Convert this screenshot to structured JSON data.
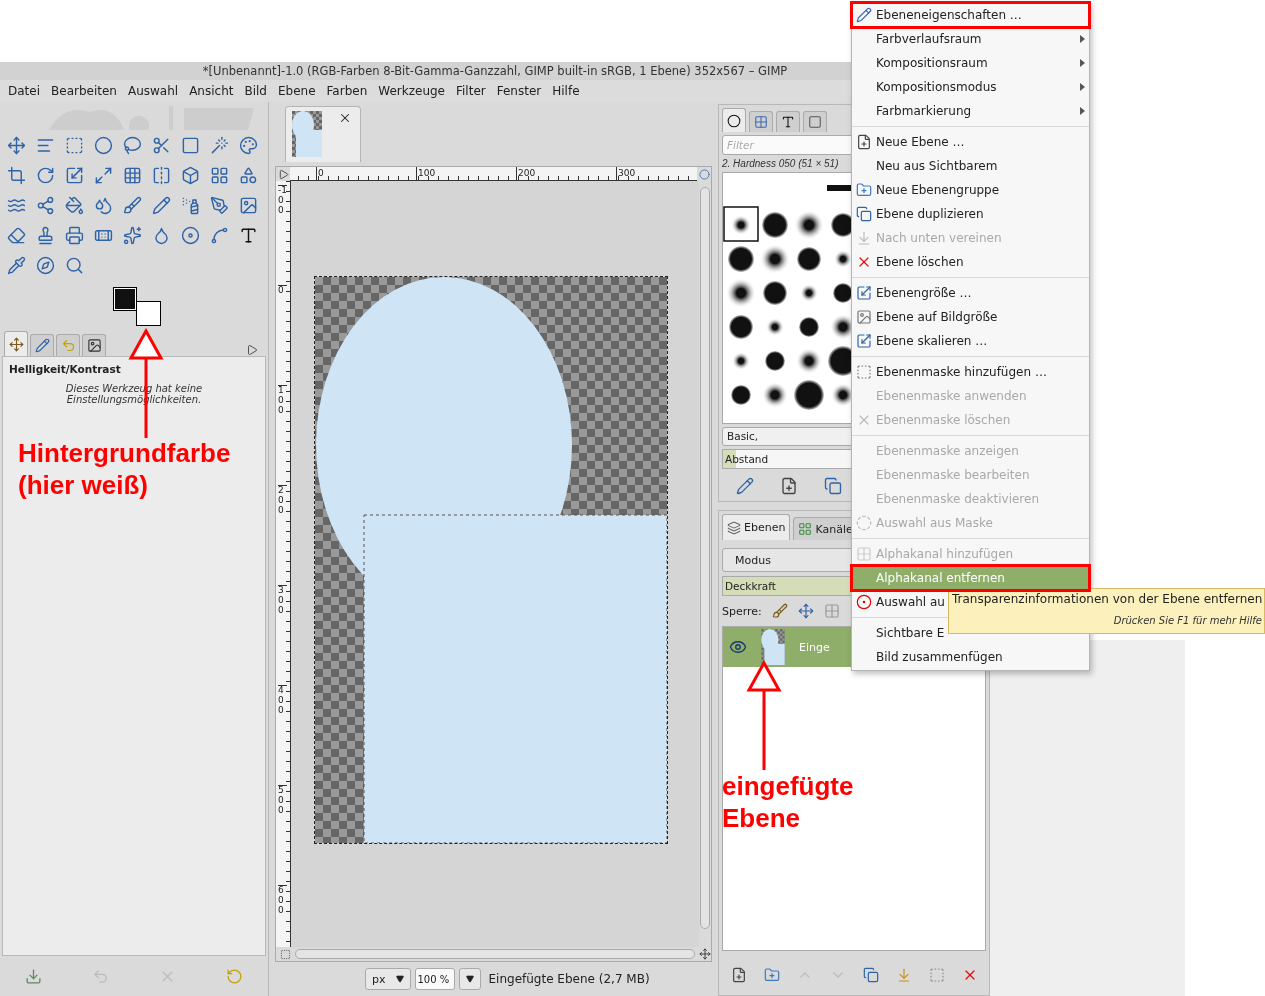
{
  "window": {
    "title": "*[Unbenannt]-1.0 (RGB-Farben 8-Bit-Gamma-Ganzzahl, GIMP built-in sRGB, 1 Ebene) 352x567 – GIMP"
  },
  "menubar": [
    "Datei",
    "Bearbeiten",
    "Auswahl",
    "Ansicht",
    "Bild",
    "Ebene",
    "Farben",
    "Werkzeuge",
    "Filter",
    "Fenster",
    "Hilfe"
  ],
  "toolbox": {
    "options_tabs": [
      {
        "selected": true
      },
      {
        "selected": false
      },
      {
        "selected": false
      },
      {
        "selected": false
      }
    ]
  },
  "tool_options": {
    "title": "Helligkeit/Kontrast",
    "message": "Dieses Werkzeug hat keine Einstellungsmöglichkeiten."
  },
  "image_window": {
    "horizontal_ruler": [
      "0",
      "100",
      "200",
      "300"
    ],
    "vertical_ruler": [
      "-100",
      "0",
      "100",
      "200",
      "300",
      "400",
      "500",
      "600"
    ],
    "unit": "px",
    "zoom": "100 %",
    "status": "Eingefügte Ebene (2,7 MB)"
  },
  "brushes": {
    "tabs": [
      {
        "selected": true
      },
      {
        "selected": false
      },
      {
        "selected": false
      },
      {
        "selected": false
      }
    ],
    "filter_placeholder": "Filter",
    "current": "2. Hardness 050 (51 × 51)",
    "tags": "Basic,",
    "spacing": {
      "label": "Abstand",
      "level": 0.05
    }
  },
  "layers": {
    "tabs": [
      {
        "label": "Ebenen",
        "selected": true
      },
      {
        "label": "Kanäle",
        "selected": false
      }
    ],
    "mode": "Modus",
    "opacity": {
      "label": "Deckkraft",
      "level": 1
    },
    "lock_label": "Sperre:",
    "items": [
      {
        "name": "Einge",
        "visible": true,
        "selected": true
      }
    ]
  },
  "context_menu": {
    "sections": [
      {
        "items": [
          {
            "label": "Ebeneneigenschaften …",
            "disabled": false,
            "submenu": false,
            "highlighted": false,
            "annotated": true
          },
          {
            "label": "Farbverlaufsraum",
            "disabled": false,
            "submenu": true,
            "highlighted": false,
            "annotated": false
          },
          {
            "label": "Kompositionsraum",
            "disabled": false,
            "submenu": true,
            "highlighted": false,
            "annotated": false
          },
          {
            "label": "Kompositionsmodus",
            "disabled": false,
            "submenu": true,
            "highlighted": false,
            "annotated": false
          },
          {
            "label": "Farbmarkierung",
            "disabled": false,
            "submenu": true,
            "highlighted": false,
            "annotated": false
          }
        ]
      },
      {
        "items": [
          {
            "label": "Neue Ebene …",
            "disabled": false,
            "submenu": false,
            "highlighted": false,
            "annotated": false
          },
          {
            "label": "Neu aus Sichtbarem",
            "disabled": false,
            "submenu": false,
            "highlighted": false,
            "annotated": false
          },
          {
            "label": "Neue Ebenengruppe",
            "disabled": false,
            "submenu": false,
            "highlighted": false,
            "annotated": false
          },
          {
            "label": "Ebene duplizieren",
            "disabled": false,
            "submenu": false,
            "highlighted": false,
            "annotated": false
          },
          {
            "label": "Nach unten vereinen",
            "disabled": true,
            "submenu": false,
            "highlighted": false,
            "annotated": false
          },
          {
            "label": "Ebene löschen",
            "disabled": false,
            "submenu": false,
            "highlighted": false,
            "annotated": false
          }
        ]
      },
      {
        "items": [
          {
            "label": "Ebenengröße …",
            "disabled": false,
            "submenu": false,
            "highlighted": false,
            "annotated": false
          },
          {
            "label": "Ebene auf Bildgröße",
            "disabled": false,
            "submenu": false,
            "highlighted": false,
            "annotated": false
          },
          {
            "label": "Ebene skalieren …",
            "disabled": false,
            "submenu": false,
            "highlighted": false,
            "annotated": false
          }
        ]
      },
      {
        "items": [
          {
            "label": "Ebenenmaske hinzufügen …",
            "disabled": false,
            "submenu": false,
            "highlighted": false,
            "annotated": false
          },
          {
            "label": "Ebenenmaske anwenden",
            "disabled": true,
            "submenu": false,
            "highlighted": false,
            "annotated": false
          },
          {
            "label": "Ebenenmaske löschen",
            "disabled": true,
            "submenu": false,
            "highlighted": false,
            "annotated": false
          }
        ]
      },
      {
        "items": [
          {
            "label": "Ebenenmaske anzeigen",
            "disabled": true,
            "submenu": false,
            "highlighted": false,
            "annotated": false
          },
          {
            "label": "Ebenenmaske bearbeiten",
            "disabled": true,
            "submenu": false,
            "highlighted": false,
            "annotated": false
          },
          {
            "label": "Ebenenmaske deaktivieren",
            "disabled": true,
            "submenu": false,
            "highlighted": false,
            "annotated": false
          },
          {
            "label": "Auswahl aus Maske",
            "disabled": true,
            "submenu": false,
            "highlighted": false,
            "annotated": false
          }
        ]
      },
      {
        "items": [
          {
            "label": "Alphakanal hinzufügen",
            "disabled": true,
            "submenu": false,
            "highlighted": false,
            "annotated": false
          },
          {
            "label": "Alphakanal entfernen",
            "disabled": false,
            "submenu": false,
            "highlighted": true,
            "annotated": true
          },
          {
            "label": "Auswahl au",
            "disabled": false,
            "highlighted": false,
            "annotated": false
          }
        ]
      },
      {
        "items": [
          {
            "label": "Sichtbare E",
            "disabled": false,
            "submenu": false,
            "highlighted": false,
            "annotated": false
          },
          {
            "label": "Bild zusammenfügen",
            "disabled": false,
            "submenu": false,
            "highlighted": false,
            "annotated": false
          }
        ]
      }
    ]
  },
  "tooltip": {
    "text": "Transparenzinformationen von der Ebene entfernen",
    "hint": "Drücken Sie F1 für mehr Hilfe"
  },
  "annotations": [
    {
      "lines": [
        "Hintergrundfarbe",
        "(hier weiß)"
      ]
    },
    {
      "lines": [
        "eingefügte",
        "Ebene"
      ]
    }
  ]
}
